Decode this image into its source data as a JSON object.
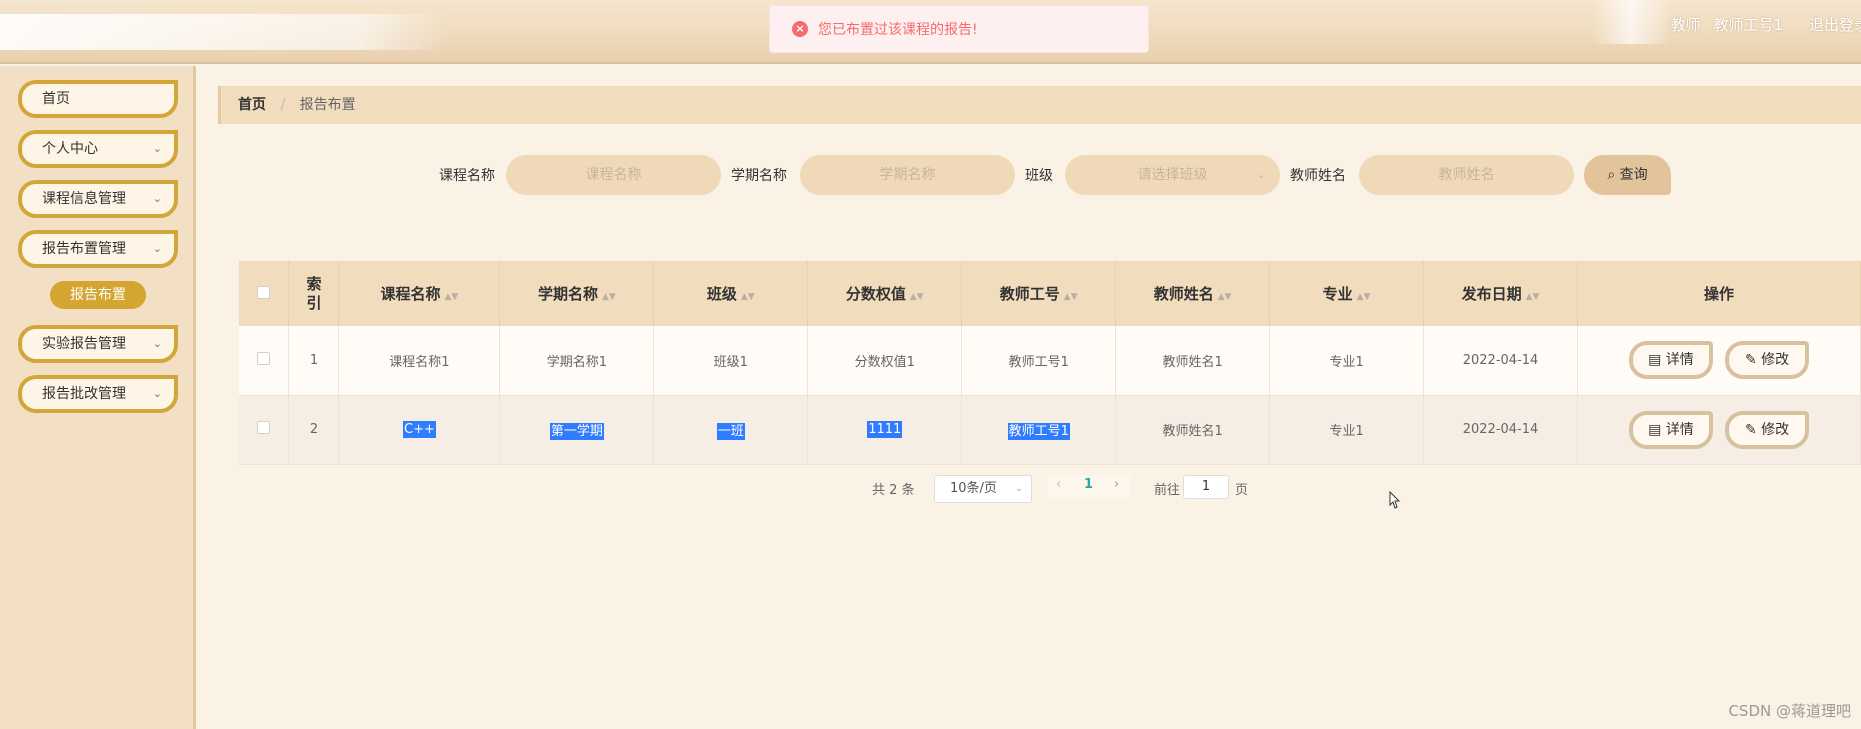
{
  "header": {
    "role": "教师",
    "user": "教师工号1",
    "logout": "退出登录"
  },
  "toast": {
    "message": "您已布置过该课程的报告!",
    "type": "error",
    "color": "#f56c6c"
  },
  "sidebar": {
    "items": [
      {
        "label": "首页"
      },
      {
        "label": "个人中心"
      },
      {
        "label": "课程信息管理"
      },
      {
        "label": "报告布置管理"
      },
      {
        "label": "实验报告管理"
      },
      {
        "label": "报告批改管理"
      }
    ],
    "active_sub": "报告布置",
    "accent": "#d4a531"
  },
  "breadcrumb": {
    "home": "首页",
    "current": "报告布置"
  },
  "search": {
    "course_label": "课程名称",
    "course_placeholder": "课程名称",
    "term_label": "学期名称",
    "term_placeholder": "学期名称",
    "class_label": "班级",
    "class_placeholder": "请选择班级",
    "teacher_label": "教师姓名",
    "teacher_placeholder": "教师姓名",
    "button": "查询"
  },
  "table": {
    "headers": [
      "索引",
      "课程名称",
      "学期名称",
      "班级",
      "分数权值",
      "教师工号",
      "教师姓名",
      "专业",
      "发布日期",
      "操作"
    ],
    "rows": [
      [
        "1",
        "课程名称1",
        "学期名称1",
        "班级1",
        "分数权值1",
        "教师工号1",
        "教师姓名1",
        "专业1",
        "2022-04-14"
      ],
      [
        "2",
        "C++",
        "第一学期",
        "一班",
        "1111",
        "教师工号1",
        "教师姓名1",
        "专业1",
        "2022-04-14"
      ]
    ],
    "detail_label": "详情",
    "edit_label": "修改"
  },
  "pager": {
    "total": "共 2 条",
    "page_size": "10条/页",
    "current_page": "1",
    "goto_label": "前往",
    "goto_value": "1",
    "page_unit": "页"
  },
  "watermark": "CSDN @蒋道理吧"
}
